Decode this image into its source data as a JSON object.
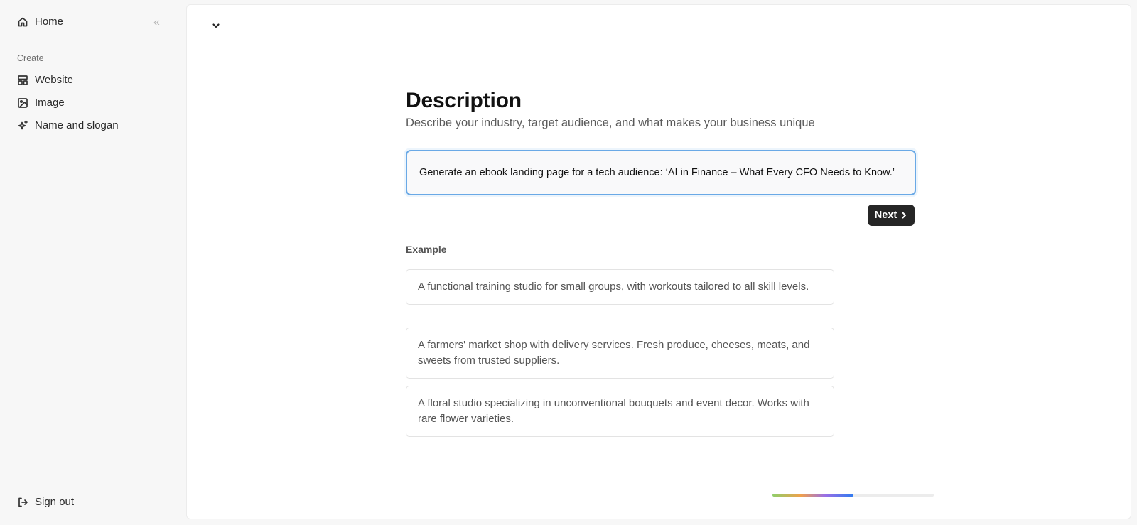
{
  "sidebar": {
    "home_label": "Home",
    "collapse_icon": "double-chevron-left-icon",
    "section_label": "Create",
    "items": [
      {
        "label": "Website",
        "icon": "layout-icon"
      },
      {
        "label": "Image",
        "icon": "image-icon"
      },
      {
        "label": "Name and slogan",
        "icon": "sparkles-icon"
      }
    ],
    "sign_out_label": "Sign out"
  },
  "main": {
    "title": "Description",
    "subtitle": "Describe your industry, target audience, and what makes your business unique",
    "input_value": "Generate an ebook landing page for a tech audience: ‘AI in Finance – What Every CFO Needs to Know.’",
    "next_label": "Next",
    "example_label": "Example",
    "examples": [
      "A functional training studio for small groups, with workouts tailored to all skill levels.",
      "A farmers' market shop with delivery services. Fresh produce, cheeses, meats, and sweets from trusted suppliers.",
      "A floral studio specializing in unconventional bouquets and event decor. Works with rare flower varieties."
    ],
    "progress_fraction": 0.5
  },
  "colors": {
    "accent_border": "#6aa9e6",
    "button_bg": "#262626"
  }
}
